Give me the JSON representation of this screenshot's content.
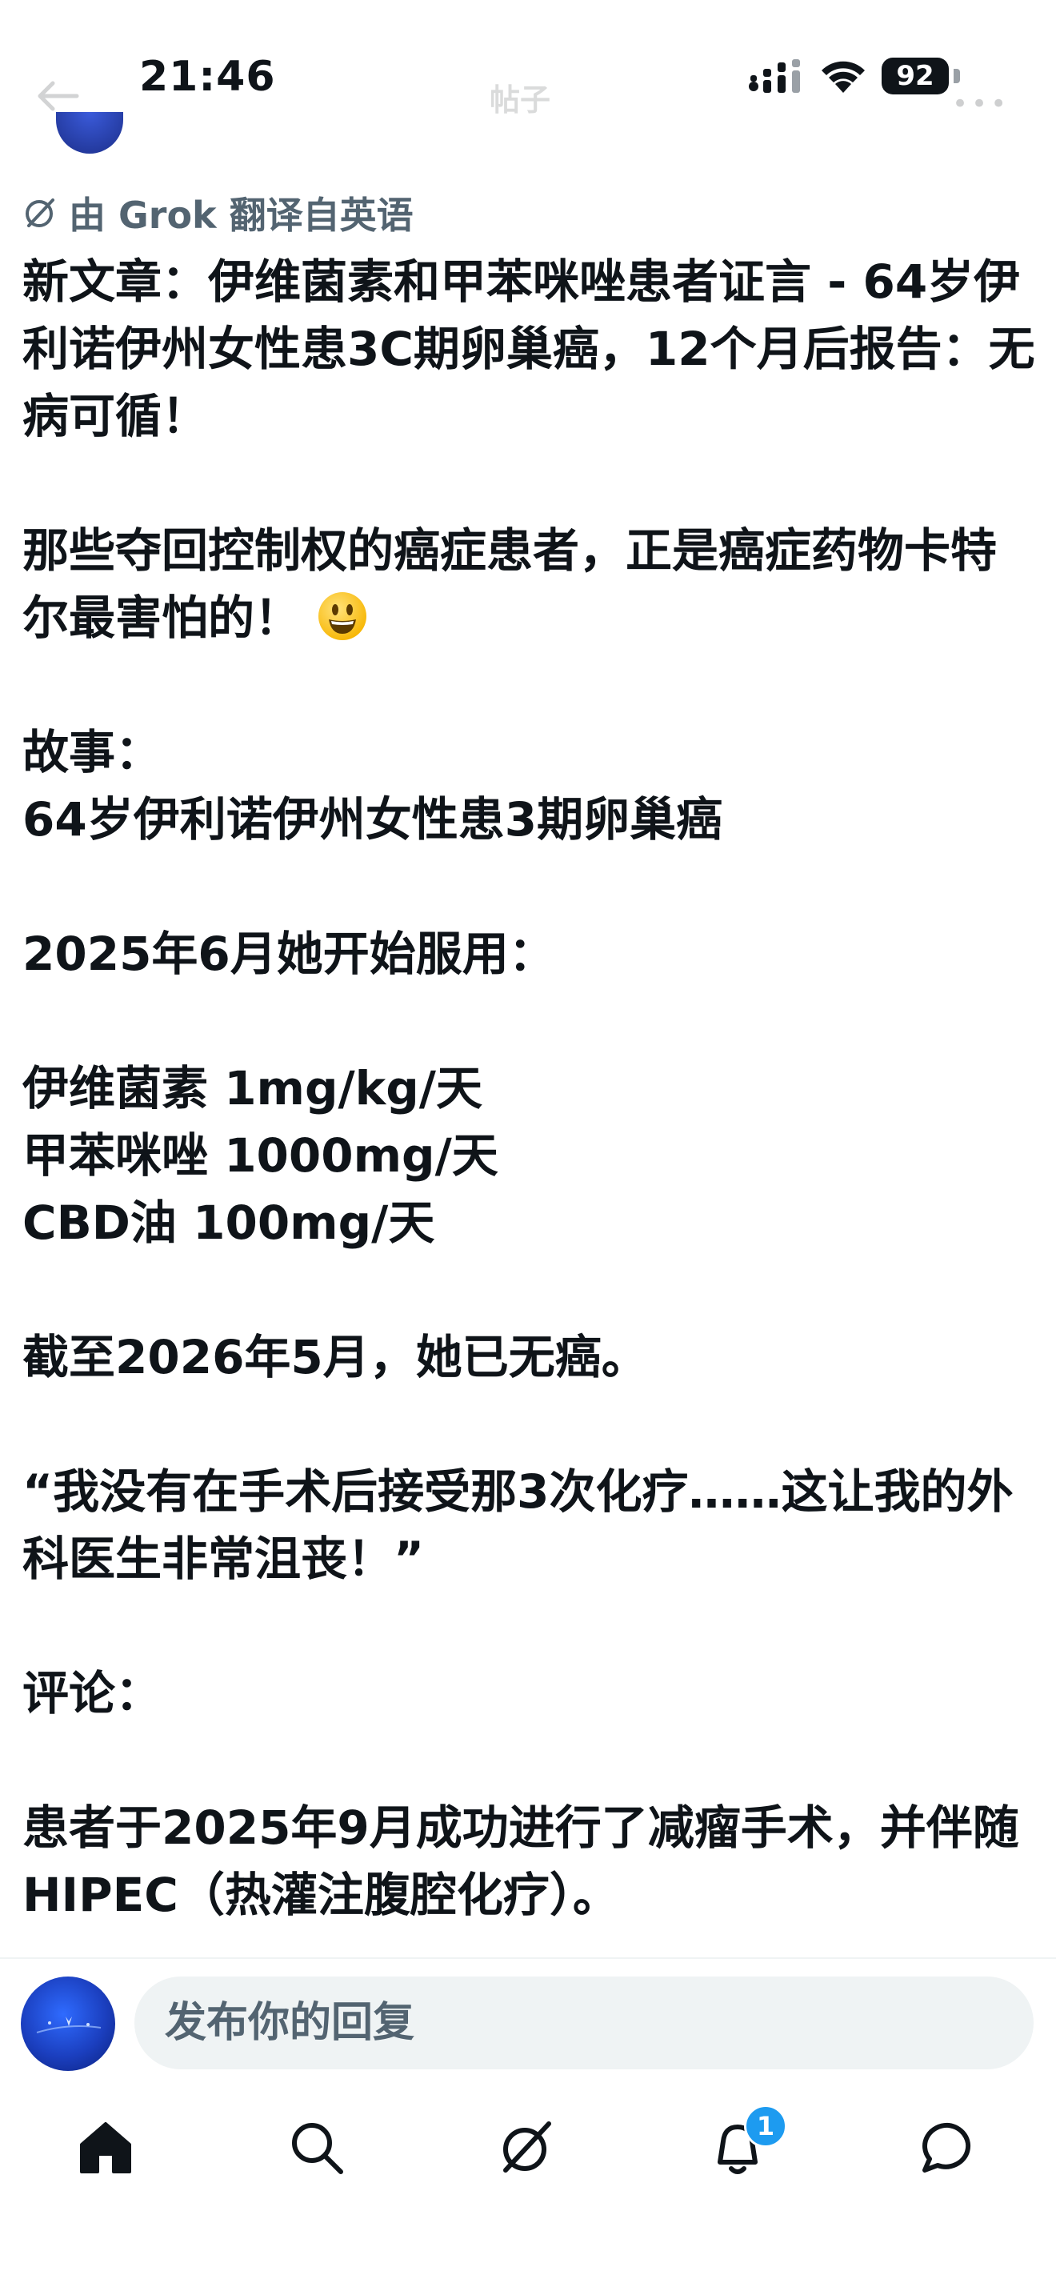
{
  "status_bar": {
    "time": "21:46",
    "battery": "92"
  },
  "header": {
    "title": "帖子"
  },
  "translation": {
    "label": "由 Grok 翻译自英语"
  },
  "post": {
    "paragraphs": [
      "新文章：伊维菌素和甲苯咪唑患者证言 - 64岁伊利诺伊州女性患3C期卵巢癌，12个月后报告：无病可循！",
      "那些夺回控制权的癌症患者，正是癌症药物卡特尔最害怕的！",
      "故事：\n64岁伊利诺伊州女性患3期卵巢癌",
      "2025年6月她开始服用：",
      "伊维菌素 1mg/kg/天\n甲苯咪唑 1000mg/天\nCBD油 100mg/天",
      "截至2026年5月，她已无癌。",
      "“我没有在手术后接受那3次化疗……这让我的外科医生非常沮丧！”",
      "评论：",
      "患者于2025年9月成功进行了减瘤手术，并伴随HIPEC（热灌注腹腔化疗）。"
    ]
  },
  "reply": {
    "placeholder": "发布你的回复"
  },
  "tab_bar": {
    "items": [
      "home-icon",
      "search-icon",
      "grok-icon",
      "notifications-icon",
      "messages-icon"
    ],
    "notification_badge": "1",
    "accent": "#1d9bf0"
  }
}
